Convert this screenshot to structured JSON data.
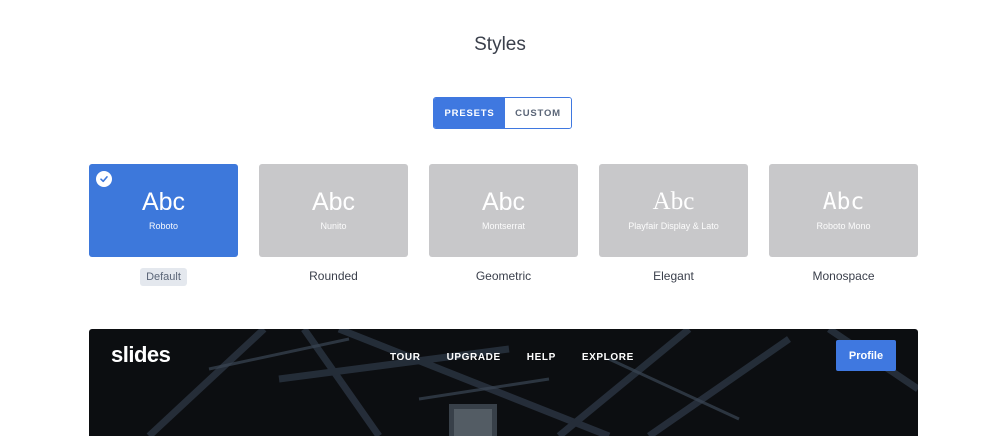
{
  "section": {
    "title": "Styles"
  },
  "mode_toggle": {
    "presets_label": "PRESETS",
    "custom_label": "CUSTOM",
    "selected": "PRESETS"
  },
  "presets": [
    {
      "sample": "Abc",
      "font_name": "Roboto",
      "label": "Default",
      "selected": true
    },
    {
      "sample": "Abc",
      "font_name": "Nunito",
      "label": "Rounded",
      "selected": false
    },
    {
      "sample": "Abc",
      "font_name": "Montserrat",
      "label": "Geometric",
      "selected": false
    },
    {
      "sample": "Abc",
      "font_name": "Playfair Display & Lato",
      "label": "Elegant",
      "selected": false
    },
    {
      "sample": "Abc",
      "font_name": "Roboto Mono",
      "label": "Monospace",
      "selected": false
    }
  ],
  "preview": {
    "logo": "slides",
    "nav": [
      "TOUR",
      "UPGRADE",
      "HELP",
      "EXPLORE"
    ],
    "profile_label": "Profile"
  },
  "colors": {
    "accent": "#3f78e0",
    "card_inactive": "#c8c8ca",
    "preview_bg": "#0c0e11"
  },
  "icons": {
    "selected_check": "check-circle-icon"
  }
}
